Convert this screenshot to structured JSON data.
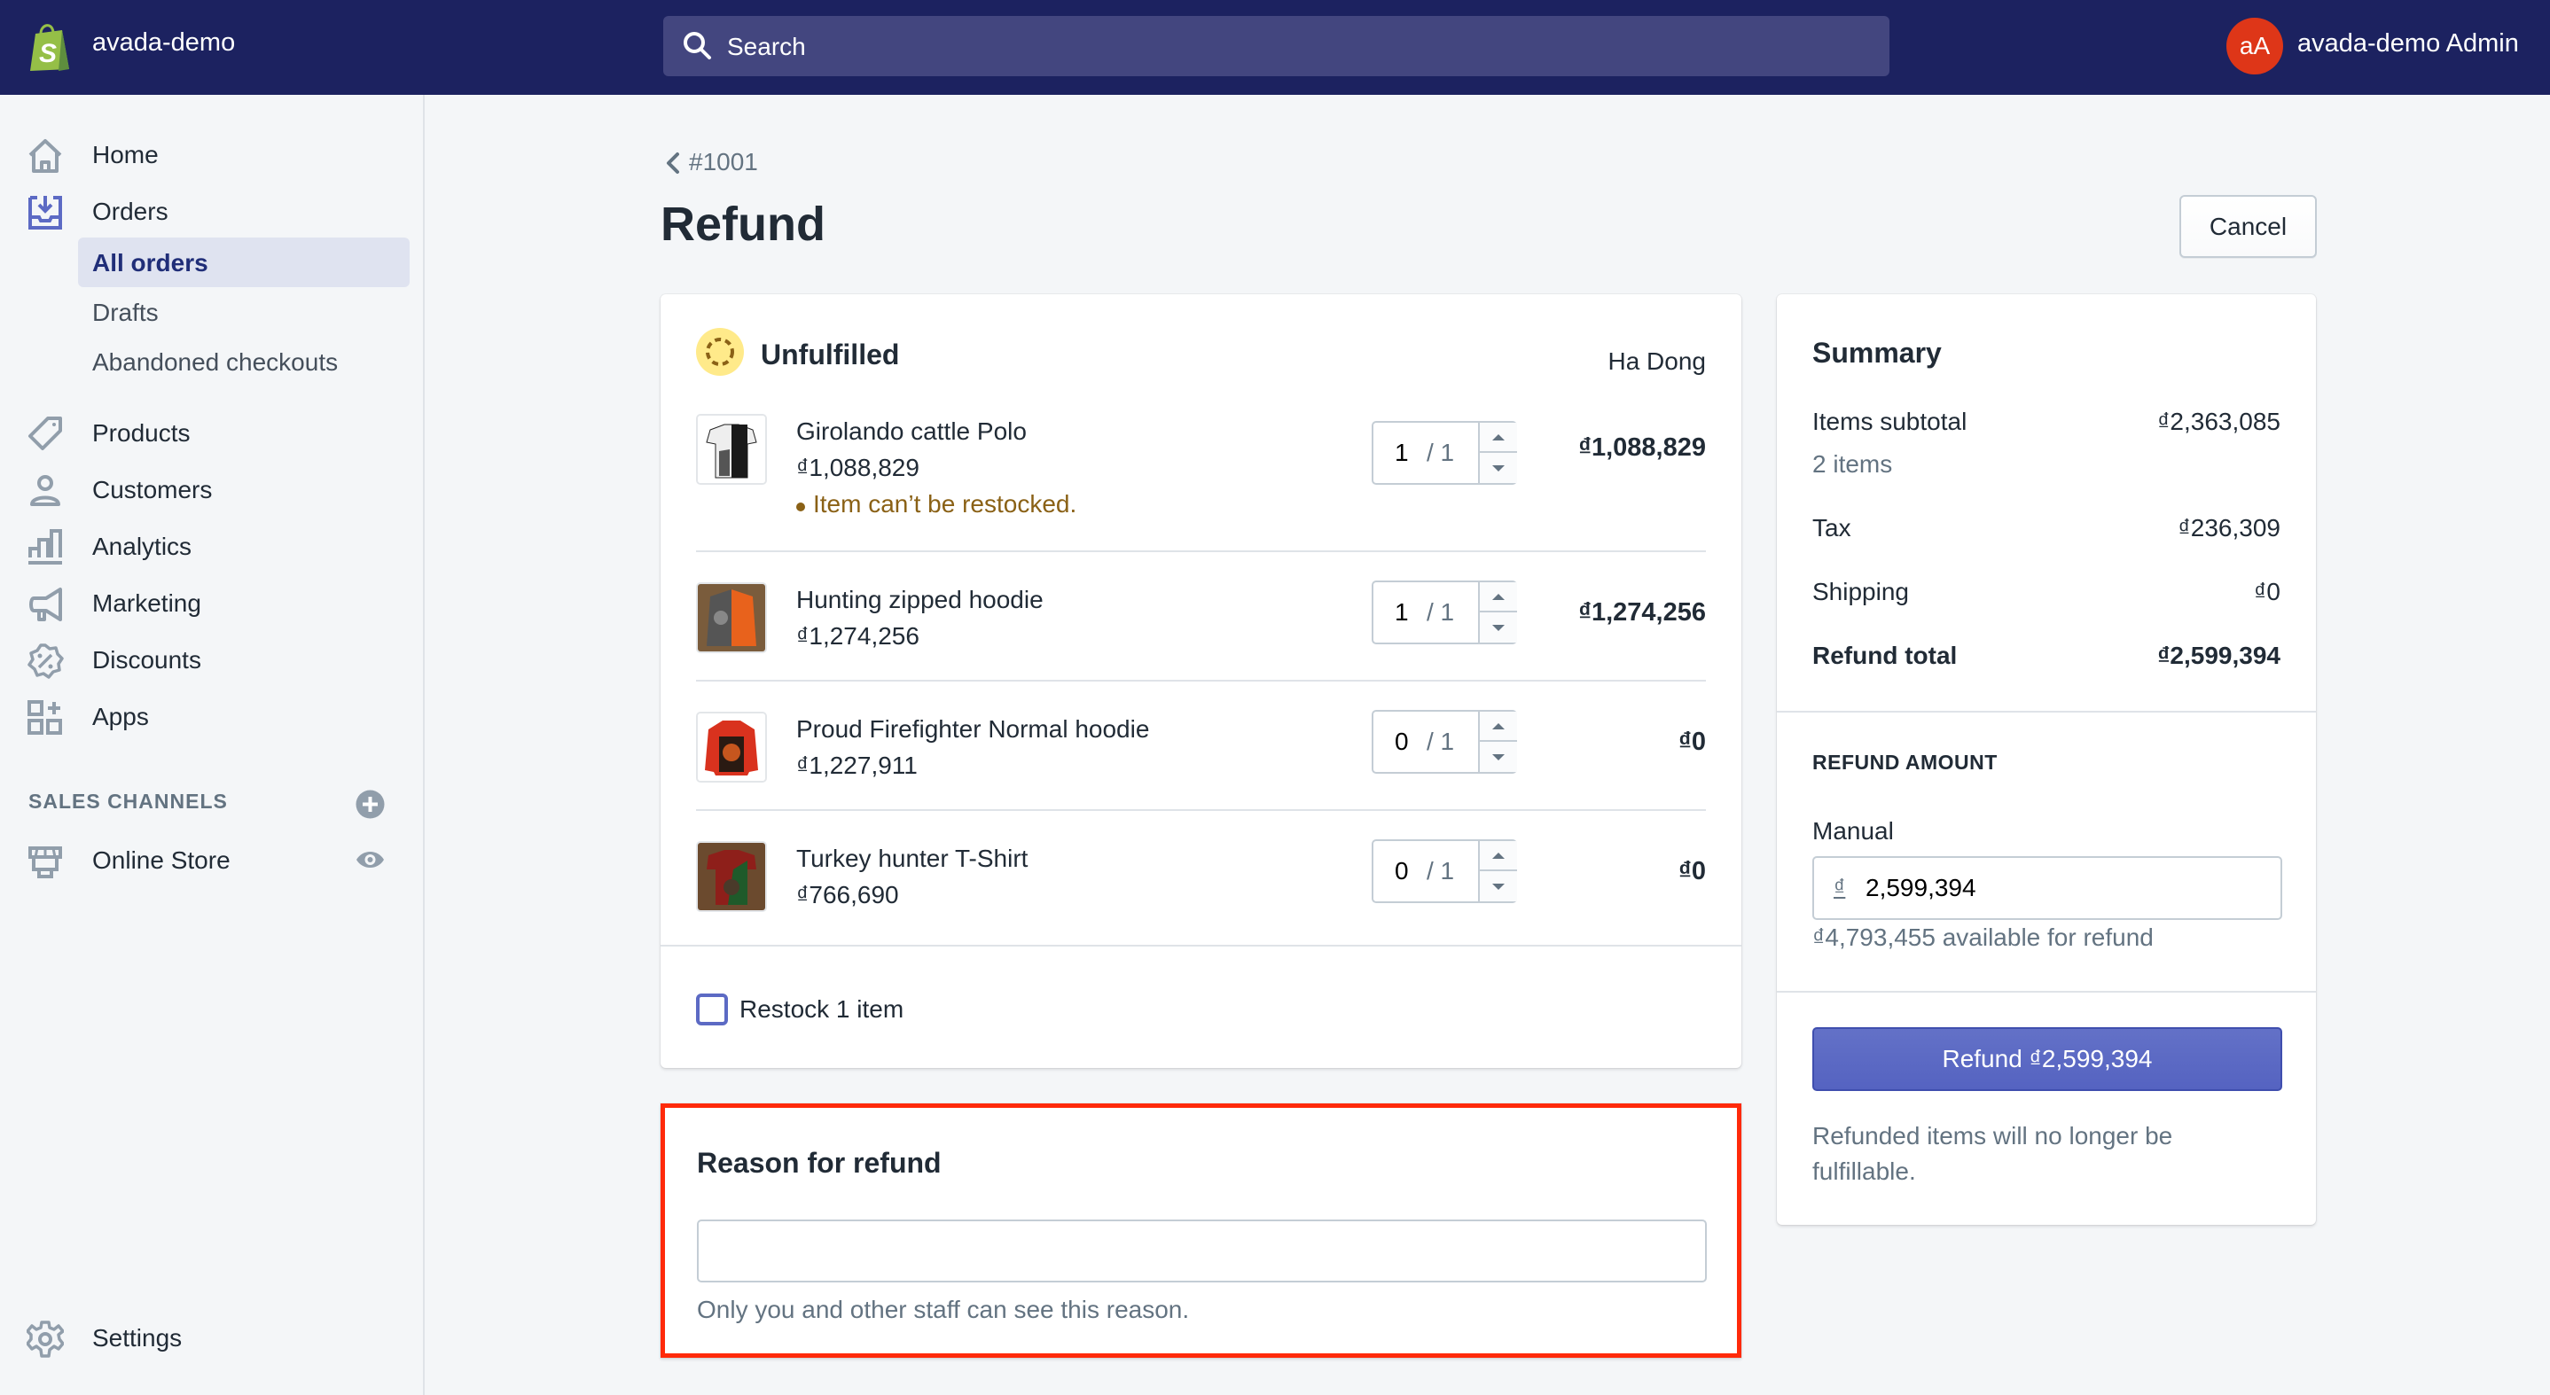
{
  "topbar": {
    "store_name": "avada-demo",
    "search_placeholder": "Search",
    "avatar_initials": "aA",
    "account_name": "avada-demo Admin"
  },
  "sidebar": {
    "items": [
      {
        "label": "Home",
        "icon": "home-icon"
      },
      {
        "label": "Orders",
        "icon": "orders-icon"
      },
      {
        "label": "Products",
        "icon": "tag-icon"
      },
      {
        "label": "Customers",
        "icon": "person-icon"
      },
      {
        "label": "Analytics",
        "icon": "bar-chart-icon"
      },
      {
        "label": "Marketing",
        "icon": "megaphone-icon"
      },
      {
        "label": "Discounts",
        "icon": "discount-icon"
      },
      {
        "label": "Apps",
        "icon": "apps-icon"
      }
    ],
    "orders_subitems": [
      {
        "label": "All orders",
        "active": true
      },
      {
        "label": "Drafts",
        "active": false
      },
      {
        "label": "Abandoned checkouts",
        "active": false
      }
    ],
    "sales_channels_title": "SALES CHANNELS",
    "channels": [
      {
        "label": "Online Store"
      }
    ],
    "settings_label": "Settings"
  },
  "page": {
    "breadcrumb": "#1001",
    "title": "Refund",
    "cancel_label": "Cancel"
  },
  "fulfillment": {
    "status": "Unfulfilled",
    "location": "Ha Dong",
    "line_items": [
      {
        "name": "Girolando cattle Polo",
        "price": "₫1,088,829",
        "quantity": "1",
        "max": "/ 1",
        "total": "₫1,088,829",
        "note": "Item can’t be restocked."
      },
      {
        "name": "Hunting zipped hoodie",
        "price": "₫1,274,256",
        "quantity": "1",
        "max": "/ 1",
        "total": "₫1,274,256"
      },
      {
        "name": "Proud Firefighter Normal hoodie",
        "price": "₫1,227,911",
        "quantity": "0",
        "max": "/ 1",
        "total": "₫0"
      },
      {
        "name": "Turkey hunter T-Shirt",
        "price": "₫766,690",
        "quantity": "0",
        "max": "/ 1",
        "total": "₫0"
      }
    ],
    "restock_label": "Restock 1 item",
    "restock_checked": false
  },
  "reason": {
    "title": "Reason for refund",
    "value": "",
    "help": "Only you and other staff can see this reason."
  },
  "summary": {
    "title": "Summary",
    "items_subtotal_label": "Items subtotal",
    "items_subtotal_value": "₫2,363,085",
    "items_count": "2 items",
    "tax_label": "Tax",
    "tax_value": "₫236,309",
    "shipping_label": "Shipping",
    "shipping_value": "₫0",
    "refund_total_label": "Refund total",
    "refund_total_value": "₫2,599,394",
    "refund_amount_title": "REFUND AMOUNT",
    "manual_label": "Manual",
    "currency_prefix": "₫",
    "manual_value": "2,599,394",
    "available": "₫4,793,455 available for refund",
    "refund_button": "Refund ₫2,599,394",
    "refund_note": "Refunded items will no longer be fulfillable."
  },
  "colors": {
    "topbar": "#1c2260",
    "primary": "#5c6ac4",
    "avatar": "#de3618",
    "warning_text": "#8a6116",
    "highlight_border": "#ff2a0a"
  }
}
